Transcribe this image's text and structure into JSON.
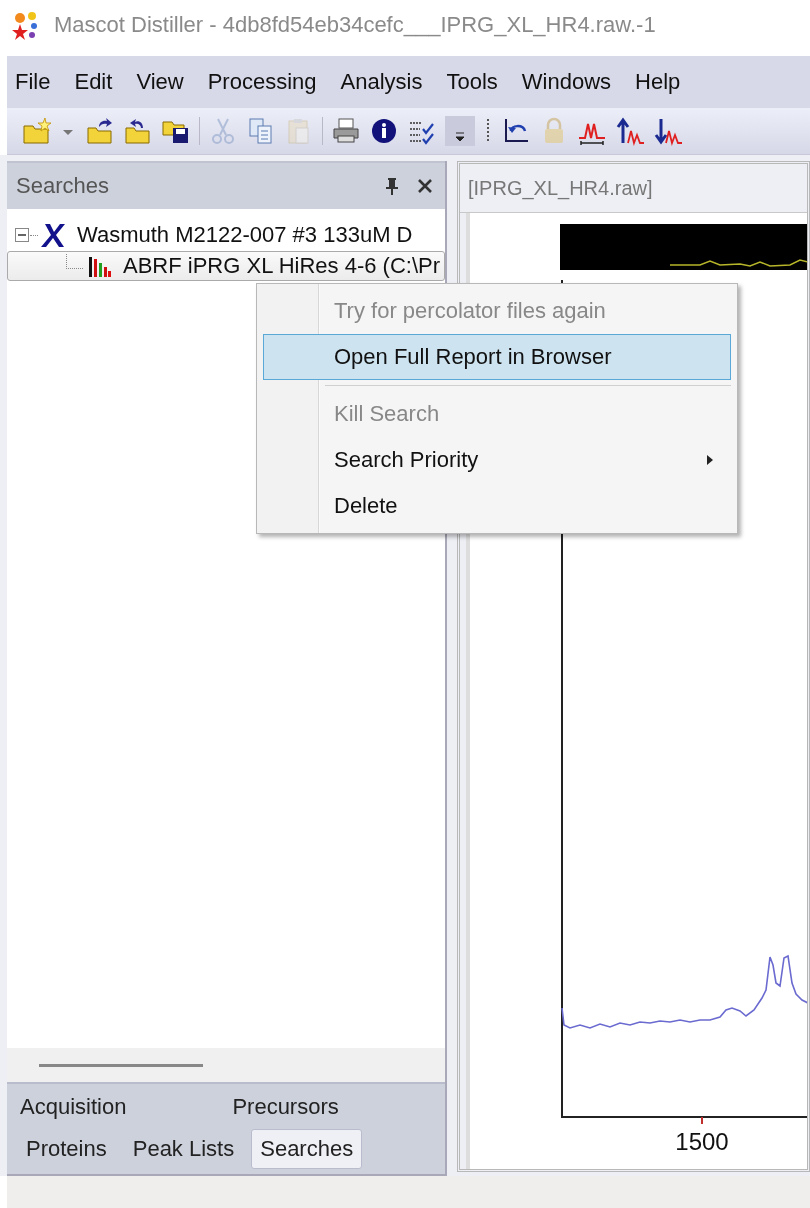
{
  "window": {
    "title": "Mascot Distiller - 4db8fd54eb34cefc___IPRG_XL_HR4.raw.-1"
  },
  "menu": [
    "File",
    "Edit",
    "View",
    "Processing",
    "Analysis",
    "Tools",
    "Windows",
    "Help"
  ],
  "toolbar": [
    {
      "kind": "new",
      "disabled": false
    },
    {
      "kind": "dropdown",
      "disabled": false
    },
    {
      "kind": "open",
      "disabled": false
    },
    {
      "kind": "reopen",
      "disabled": false
    },
    {
      "kind": "save",
      "disabled": false
    },
    {
      "kind": "sep",
      "disabled": false
    },
    {
      "kind": "cut",
      "disabled": true
    },
    {
      "kind": "copy",
      "disabled": false
    },
    {
      "kind": "paste",
      "disabled": true
    },
    {
      "kind": "sep",
      "disabled": false
    },
    {
      "kind": "print",
      "disabled": false
    },
    {
      "kind": "info",
      "disabled": false
    },
    {
      "kind": "checklist",
      "disabled": false
    },
    {
      "kind": "overflow",
      "disabled": false
    },
    {
      "kind": "grip",
      "disabled": false
    },
    {
      "kind": "undo-zoom",
      "disabled": false
    },
    {
      "kind": "lock",
      "disabled": true
    },
    {
      "kind": "peak-width",
      "disabled": false
    },
    {
      "kind": "peak-up",
      "disabled": false
    },
    {
      "kind": "peak-down",
      "disabled": false
    }
  ],
  "panel": {
    "title": "Searches",
    "tree": [
      {
        "label": "Wasmuth M2122-007 #3 133uM D",
        "kind": "search",
        "expanded": true,
        "selected": false,
        "children": [
          {
            "label": "ABRF iPRG XL HiRes 4-6 (C:\\Pr",
            "kind": "result",
            "selected": true
          }
        ]
      }
    ],
    "tabs": [
      [
        {
          "label": "Acquisition",
          "selected": false
        },
        {
          "label": "Precursors",
          "selected": false
        }
      ],
      [
        {
          "label": "Proteins",
          "selected": false
        },
        {
          "label": "Peak Lists",
          "selected": false
        },
        {
          "label": "Searches",
          "selected": true
        }
      ]
    ]
  },
  "document": {
    "title": "[IPRG_XL_HR4.raw]",
    "x_tick_label": "1500"
  },
  "context_menu": [
    {
      "kind": "item",
      "label": "Try for percolator files again",
      "disabled": true,
      "selected": false,
      "submenu": false
    },
    {
      "kind": "item",
      "label": "Open Full Report in Browser",
      "disabled": false,
      "selected": true,
      "submenu": false
    },
    {
      "kind": "separator"
    },
    {
      "kind": "item",
      "label": "Kill Search",
      "disabled": true,
      "selected": false,
      "submenu": false
    },
    {
      "kind": "item",
      "label": "Search Priority",
      "disabled": false,
      "selected": false,
      "submenu": true
    },
    {
      "kind": "item",
      "label": "Delete",
      "disabled": false,
      "selected": false,
      "submenu": false
    }
  ]
}
